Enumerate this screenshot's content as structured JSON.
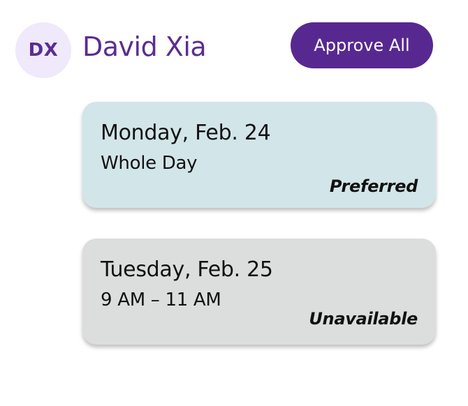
{
  "user": {
    "initials": "DX",
    "name": "David Xia"
  },
  "actions": {
    "approve_all_label": "Approve All"
  },
  "requests": [
    {
      "date": "Monday, Feb. 24",
      "time": "Whole Day",
      "status": "Preferred",
      "color": "#d2e5e9"
    },
    {
      "date": "Tuesday, Feb. 25",
      "time": "9 AM – 11 AM",
      "status": "Unavailable",
      "color": "#dcdddd"
    }
  ],
  "colors": {
    "accent": "#582891",
    "avatar_bg": "#efe9fb"
  }
}
